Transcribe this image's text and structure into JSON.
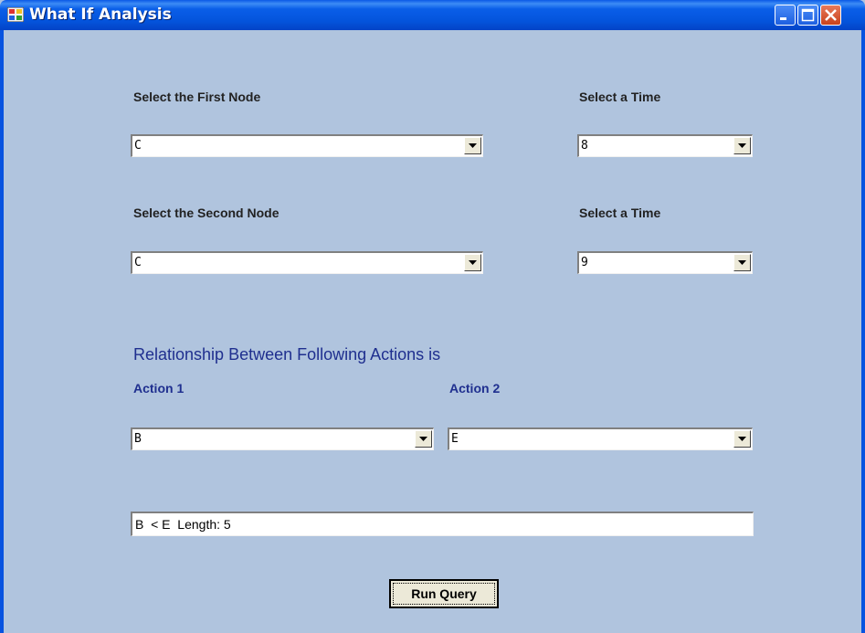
{
  "window": {
    "title": "What If Analysis"
  },
  "first_node": {
    "label": "Select the First Node",
    "value": "C"
  },
  "first_time": {
    "label": "Select a Time",
    "value": "8"
  },
  "second_node": {
    "label": "Select the Second Node",
    "value": "C"
  },
  "second_time": {
    "label": "Select a Time",
    "value": "9"
  },
  "relationship": {
    "heading": "Relationship Between Following Actions is",
    "action1_label": "Action 1",
    "action1_value": "B",
    "action2_label": "Action 2",
    "action2_value": "E",
    "result": "B  < E  Length: 5"
  },
  "run_button": {
    "label": "Run Query"
  },
  "icons": [
    "app-icon",
    "minimize-icon",
    "maximize-icon",
    "close-icon",
    "dropdown-arrow-icon"
  ],
  "colors": {
    "background": "#b0c4de",
    "titlebar": "#0a5ee8",
    "label_blue": "#1f2f8f"
  }
}
